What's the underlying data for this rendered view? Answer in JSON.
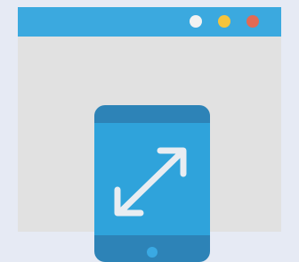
{
  "window": {
    "titlebar_color": "#3ba9df",
    "content_color": "#e1e1e1",
    "controls": [
      {
        "name": "white-dot",
        "color": "#f2f2f2"
      },
      {
        "name": "yellow-dot",
        "color": "#f5c43c"
      },
      {
        "name": "red-dot",
        "color": "#e26a55"
      }
    ]
  },
  "device": {
    "icon": "resize-arrows-icon",
    "body_color": "#2fa3db",
    "bezel_color": "#2d83b7",
    "home_button_color": "#3aa9e3"
  }
}
